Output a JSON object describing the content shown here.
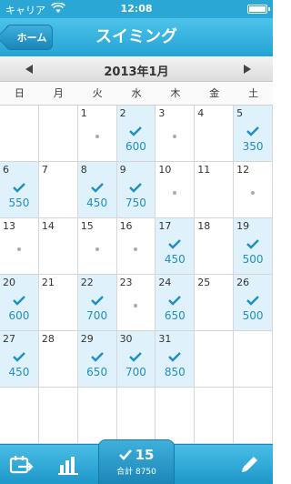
{
  "status": {
    "carrier": "キャリア",
    "time": "12:08"
  },
  "nav": {
    "back": "ホーム",
    "title": "スイミング"
  },
  "month": {
    "title": "2013年1月"
  },
  "weekdays": [
    "日",
    "月",
    "火",
    "水",
    "木",
    "金",
    "土"
  ],
  "accent": "#2aa7d4",
  "days": [
    {
      "num": "",
      "done": false,
      "dot": false,
      "val": ""
    },
    {
      "num": "",
      "done": false,
      "dot": false,
      "val": ""
    },
    {
      "num": "1",
      "done": false,
      "dot": true,
      "val": ""
    },
    {
      "num": "2",
      "done": true,
      "dot": false,
      "val": "600"
    },
    {
      "num": "3",
      "done": false,
      "dot": true,
      "val": ""
    },
    {
      "num": "4",
      "done": false,
      "dot": false,
      "val": ""
    },
    {
      "num": "5",
      "done": true,
      "dot": false,
      "val": "350"
    },
    {
      "num": "6",
      "done": true,
      "dot": false,
      "val": "550"
    },
    {
      "num": "7",
      "done": false,
      "dot": false,
      "val": ""
    },
    {
      "num": "8",
      "done": true,
      "dot": false,
      "val": "450"
    },
    {
      "num": "9",
      "done": true,
      "dot": false,
      "val": "750"
    },
    {
      "num": "10",
      "done": false,
      "dot": true,
      "val": ""
    },
    {
      "num": "11",
      "done": false,
      "dot": false,
      "val": ""
    },
    {
      "num": "12",
      "done": false,
      "dot": true,
      "val": ""
    },
    {
      "num": "13",
      "done": false,
      "dot": true,
      "val": ""
    },
    {
      "num": "14",
      "done": false,
      "dot": false,
      "val": ""
    },
    {
      "num": "15",
      "done": false,
      "dot": true,
      "val": ""
    },
    {
      "num": "16",
      "done": false,
      "dot": true,
      "val": ""
    },
    {
      "num": "17",
      "done": true,
      "dot": false,
      "val": "450"
    },
    {
      "num": "18",
      "done": false,
      "dot": false,
      "val": ""
    },
    {
      "num": "19",
      "done": true,
      "dot": false,
      "val": "500"
    },
    {
      "num": "20",
      "done": true,
      "dot": false,
      "val": "600"
    },
    {
      "num": "21",
      "done": false,
      "dot": false,
      "val": ""
    },
    {
      "num": "22",
      "done": true,
      "dot": false,
      "val": "700"
    },
    {
      "num": "23",
      "done": false,
      "dot": true,
      "val": ""
    },
    {
      "num": "24",
      "done": true,
      "dot": false,
      "val": "650"
    },
    {
      "num": "25",
      "done": false,
      "dot": false,
      "val": ""
    },
    {
      "num": "26",
      "done": true,
      "dot": false,
      "val": "500"
    },
    {
      "num": "27",
      "done": true,
      "dot": false,
      "val": "450"
    },
    {
      "num": "28",
      "done": false,
      "dot": false,
      "val": ""
    },
    {
      "num": "29",
      "done": true,
      "dot": false,
      "val": "650"
    },
    {
      "num": "30",
      "done": true,
      "dot": false,
      "val": "700"
    },
    {
      "num": "31",
      "done": true,
      "dot": false,
      "val": "850"
    },
    {
      "num": "",
      "done": false,
      "dot": false,
      "val": ""
    },
    {
      "num": "",
      "done": false,
      "dot": false,
      "val": ""
    },
    {
      "num": "",
      "done": false,
      "dot": false,
      "val": ""
    },
    {
      "num": "",
      "done": false,
      "dot": false,
      "val": ""
    },
    {
      "num": "",
      "done": false,
      "dot": false,
      "val": ""
    },
    {
      "num": "",
      "done": false,
      "dot": false,
      "val": ""
    },
    {
      "num": "",
      "done": false,
      "dot": false,
      "val": ""
    },
    {
      "num": "",
      "done": false,
      "dot": false,
      "val": ""
    },
    {
      "num": "",
      "done": false,
      "dot": false,
      "val": ""
    }
  ],
  "summary": {
    "count": "15",
    "total": "合計 8750"
  },
  "icons": {
    "calendar": "calendar-icon",
    "chart": "bar-chart-icon",
    "edit": "pencil-icon",
    "check": "check-icon"
  }
}
